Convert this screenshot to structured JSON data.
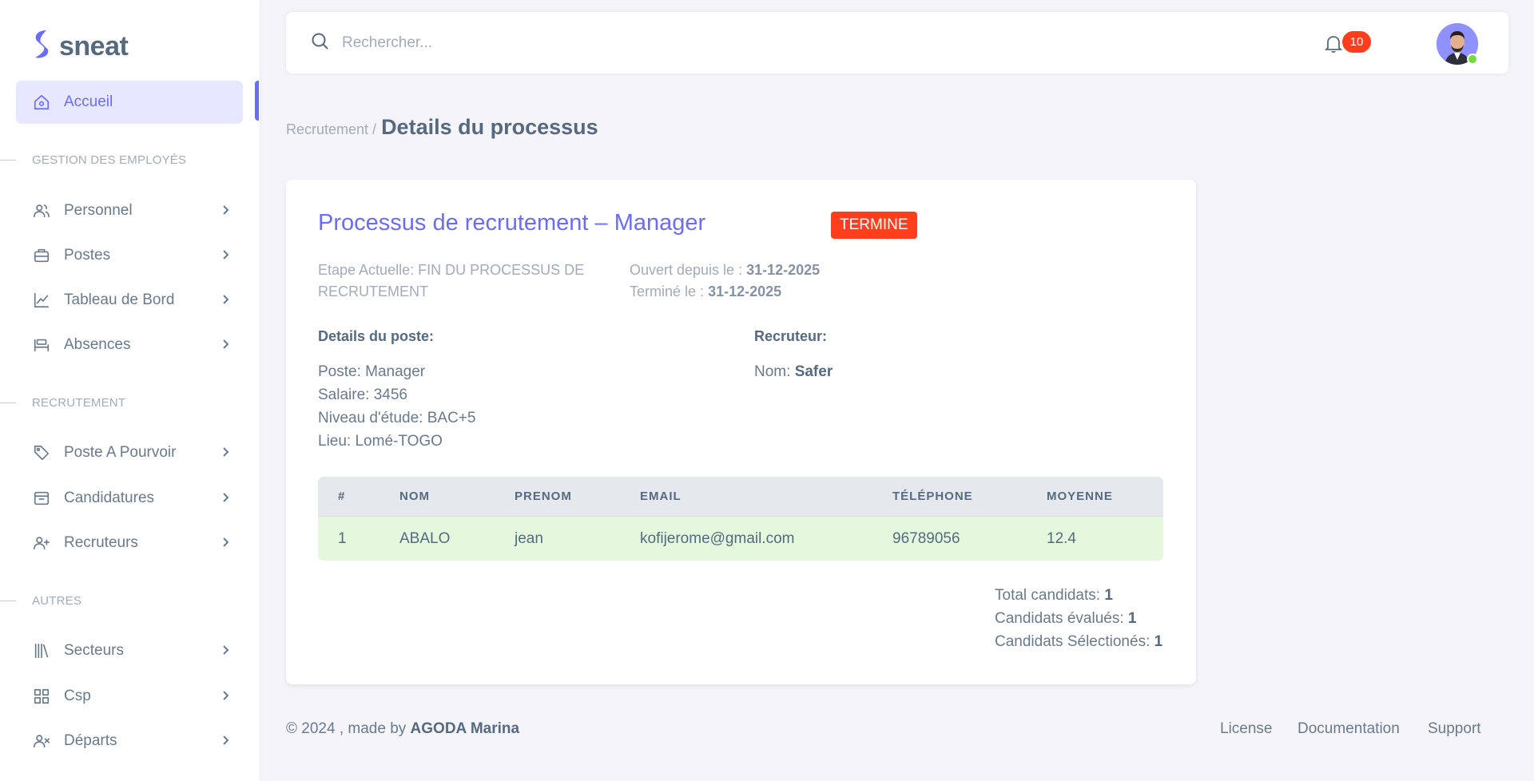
{
  "brand": {
    "name": "sneat",
    "accent": "#696cff"
  },
  "sidebar": {
    "home": {
      "label": "Accueil",
      "icon": "home-icon"
    },
    "sections": [
      {
        "title": "GESTION DES EMPLOYÉS"
      },
      {
        "title": "RECRUTEMENT"
      },
      {
        "title": "AUTRES"
      }
    ],
    "items": [
      {
        "label": "Personnel",
        "icon": "users-icon"
      },
      {
        "label": "Postes",
        "icon": "briefcase-icon"
      },
      {
        "label": "Tableau de Bord",
        "icon": "chart-line-icon"
      },
      {
        "label": "Absences",
        "icon": "bed-icon"
      },
      {
        "label": "Poste A Pourvoir",
        "icon": "tag-icon"
      },
      {
        "label": "Candidatures",
        "icon": "inbox-icon"
      },
      {
        "label": "Recruteurs",
        "icon": "user-plus-icon"
      },
      {
        "label": "Secteurs",
        "icon": "library-icon"
      },
      {
        "label": "Csp",
        "icon": "grid-icon"
      },
      {
        "label": "Départs",
        "icon": "user-x-icon"
      }
    ]
  },
  "navbar": {
    "search_placeholder": "Rechercher...",
    "notification_count": "10"
  },
  "breadcrumb": {
    "parent": "Recrutement",
    "separator": "/",
    "current": "Details du processus"
  },
  "process": {
    "title": "Processus de recrutement – Manager",
    "status": "TERMINE",
    "status_color": "#ff3e1d",
    "stage_line1": "Etape Actuelle: FIN DU PROCESSUS DE",
    "stage_line2": "RECRUTEMENT",
    "opened_label": "Ouvert depuis le :",
    "opened_value": "31-12-2025",
    "closed_label": "Terminé le :",
    "closed_value": "31-12-2025",
    "post_details_heading": "Details du poste:",
    "post": {
      "poste": "Poste: Manager",
      "salaire": "Salaire: 3456",
      "niveau": "Niveau d'étude: BAC+5",
      "lieu": "Lieu: Lomé-TOGO"
    },
    "recruiter_heading": "Recruteur:",
    "recruiter_name_label": "Nom:",
    "recruiter_name": "Safer"
  },
  "candidates_table": {
    "headers": [
      "#",
      "NOM",
      "PRENOM",
      "EMAIL",
      "TÉLÉPHONE",
      "MOYENNE"
    ],
    "rows": [
      [
        "1",
        "ABALO",
        "jean",
        "kofijerome@gmail.com",
        "96789056",
        "12.4"
      ]
    ],
    "row_highlight_color": "#e4f8dd"
  },
  "totals": {
    "total_label": "Total candidats:",
    "total_value": "1",
    "evaluated_label": "Candidats évalués:",
    "evaluated_value": "1",
    "selected_label": "Candidats Sélectionés:",
    "selected_value": "1"
  },
  "footer": {
    "copyright": "© 2024 , made by",
    "author": "AGODA Marina",
    "links": [
      "License",
      "Documentation",
      "Support"
    ]
  }
}
